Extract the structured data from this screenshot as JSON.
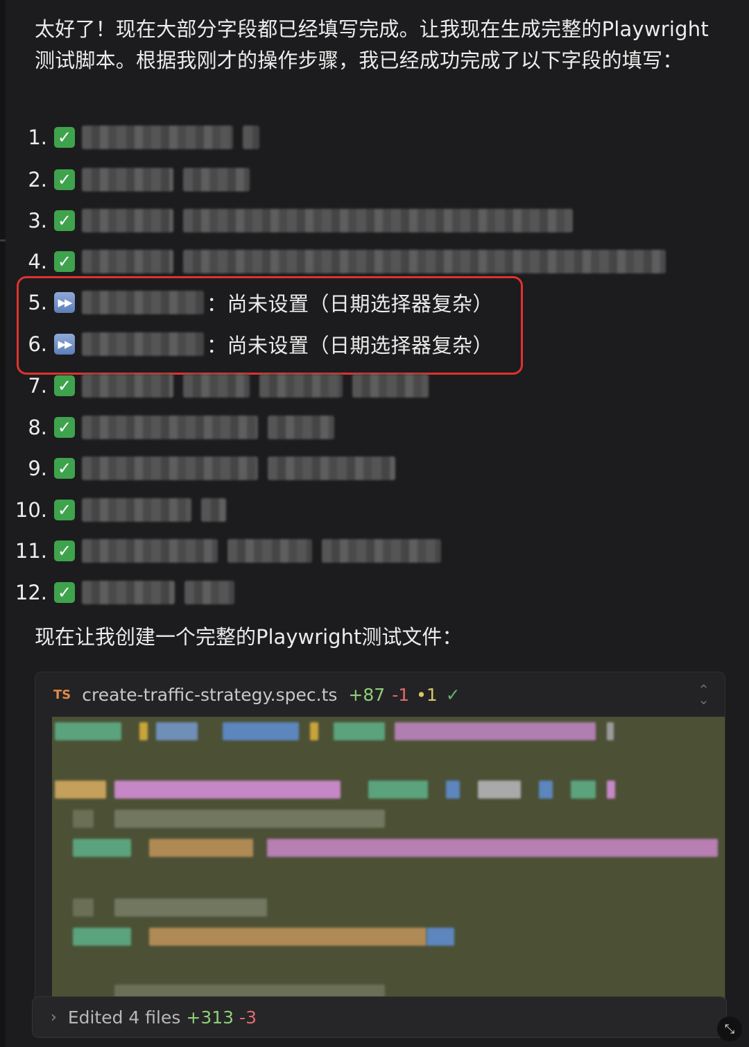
{
  "intro": "太好了！现在大部分字段都已经填写完成。让我现在生成完整的Playwright测试脚本。根据我刚才的操作步骤，我已经成功完成了以下字段的填写：",
  "items": [
    {
      "num": "1.",
      "status": "done",
      "text": ""
    },
    {
      "num": "2.",
      "status": "done",
      "text": ""
    },
    {
      "num": "3.",
      "status": "done",
      "text": ""
    },
    {
      "num": "4.",
      "status": "done",
      "text": ""
    },
    {
      "num": "5.",
      "status": "skip",
      "text": "：尚未设置（日期选择器复杂）"
    },
    {
      "num": "6.",
      "status": "skip",
      "text": "：尚未设置（日期选择器复杂）"
    },
    {
      "num": "7.",
      "status": "done",
      "text": ""
    },
    {
      "num": "8.",
      "status": "done",
      "text": ""
    },
    {
      "num": "9.",
      "status": "done",
      "text": ""
    },
    {
      "num": "10.",
      "status": "done",
      "text": ""
    },
    {
      "num": "11.",
      "status": "done",
      "text": ""
    },
    {
      "num": "12.",
      "status": "done",
      "text": ""
    }
  ],
  "after_text": "现在让我创建一个完整的Playwright测试文件：",
  "code_card": {
    "lang_badge": "TS",
    "file_name": "create-traffic-strategy.spec.ts",
    "additions": "+87",
    "deletions": "-1",
    "modified": "•1",
    "status_icon": "check-icon"
  },
  "edited_bar": {
    "label": "Edited 4 files",
    "additions": "+313",
    "deletions": "-3"
  },
  "icons": {
    "done": "check-box-icon",
    "skip": "skip-forward-icon"
  },
  "colors": {
    "background": "#1c1c1e",
    "done_green": "#3fa34d",
    "highlight_red": "#e0322f",
    "diff_add": "#8fcf7a",
    "diff_del": "#e06b6b"
  }
}
